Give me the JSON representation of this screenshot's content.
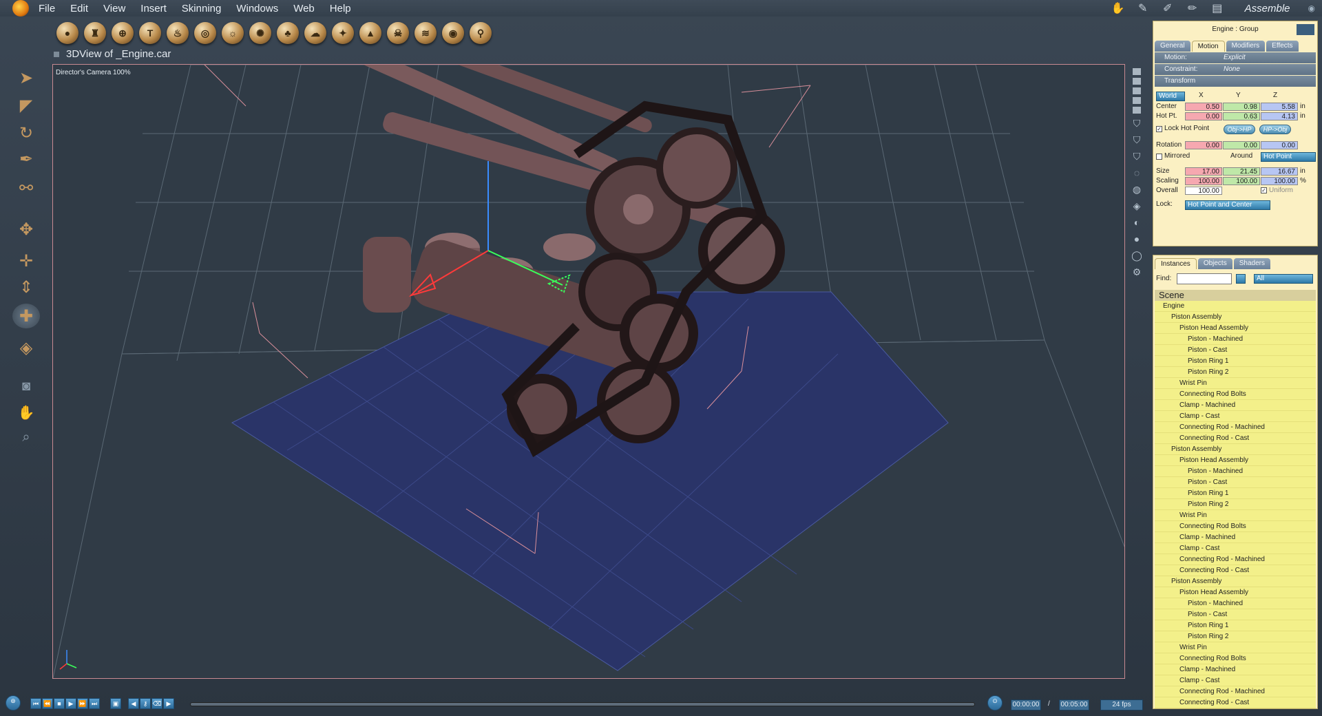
{
  "menubar": {
    "items": [
      "File",
      "Edit",
      "View",
      "Insert",
      "Skinning",
      "Windows",
      "Web",
      "Help"
    ],
    "mode": "Assemble"
  },
  "viewport": {
    "title": "3DView of _Engine.car",
    "camera_label": "Director's Camera 100%"
  },
  "properties": {
    "header": "Engine : Group",
    "tabs": [
      "General",
      "Motion",
      "Modifiers",
      "Effects"
    ],
    "active_tab": "Motion",
    "motion": {
      "label": "Motion:",
      "value": "Explicit"
    },
    "constraint": {
      "label": "Constraint:",
      "value": "None"
    },
    "transform_label": "Transform",
    "space": "World",
    "axes": [
      "X",
      "Y",
      "Z"
    ],
    "center": {
      "label": "Center",
      "x": "0.50",
      "y": "0.98",
      "z": "5.58",
      "unit": "in"
    },
    "hotpoint": {
      "label": "Hot Pt.",
      "x": "0.00",
      "y": "0.63",
      "z": "4.13",
      "unit": "in"
    },
    "lock_hot_point": {
      "label": "Lock Hot Point",
      "checked": true
    },
    "obj_hp_button": "Obj->HP",
    "hp_obj_button": "HP->Obj",
    "rotation": {
      "label": "Rotation",
      "x": "0.00",
      "y": "0.00",
      "z": "0.00"
    },
    "mirrored": {
      "label": "Mirrored",
      "checked": false
    },
    "around": {
      "label": "Around",
      "value": "Hot Point"
    },
    "size": {
      "label": "Size",
      "x": "17.00",
      "y": "21.45",
      "z": "16.67",
      "unit": "in"
    },
    "scaling": {
      "label": "Scaling",
      "x": "100.00",
      "y": "100.00",
      "z": "100.00",
      "unit": "%"
    },
    "overall": {
      "label": "Overall",
      "value": "100.00"
    },
    "uniform": {
      "label": "Uniform",
      "checked": true
    },
    "lock": {
      "label": "Lock:",
      "value": "Hot Point and Center"
    }
  },
  "instances": {
    "tabs": [
      "Instances",
      "Objects",
      "Shaders"
    ],
    "active_tab": "Instances",
    "find_label": "Find:",
    "find_value": "",
    "filter": "All",
    "scene_label": "Scene",
    "tree": [
      {
        "label": "Engine",
        "level": 0
      },
      {
        "label": "Piston Assembly",
        "level": 1
      },
      {
        "label": "Piston Head Assembly",
        "level": 2
      },
      {
        "label": "Piston - Machined",
        "level": 3
      },
      {
        "label": "Piston - Cast",
        "level": 3
      },
      {
        "label": "Piston Ring 1",
        "level": 3
      },
      {
        "label": "Piston Ring 2",
        "level": 3
      },
      {
        "label": "Wrist Pin",
        "level": 2
      },
      {
        "label": "Connecting Rod Bolts",
        "level": 2
      },
      {
        "label": "Clamp - Machined",
        "level": 2
      },
      {
        "label": "Clamp - Cast",
        "level": 2
      },
      {
        "label": "Connecting Rod - Machined",
        "level": 2
      },
      {
        "label": "Connecting Rod - Cast",
        "level": 2
      },
      {
        "label": "Piston Assembly",
        "level": 1
      },
      {
        "label": "Piston Head Assembly",
        "level": 2
      },
      {
        "label": "Piston - Machined",
        "level": 3
      },
      {
        "label": "Piston - Cast",
        "level": 3
      },
      {
        "label": "Piston Ring 1",
        "level": 3
      },
      {
        "label": "Piston Ring 2",
        "level": 3
      },
      {
        "label": "Wrist Pin",
        "level": 2
      },
      {
        "label": "Connecting Rod Bolts",
        "level": 2
      },
      {
        "label": "Clamp - Machined",
        "level": 2
      },
      {
        "label": "Clamp - Cast",
        "level": 2
      },
      {
        "label": "Connecting Rod - Machined",
        "level": 2
      },
      {
        "label": "Connecting Rod - Cast",
        "level": 2
      },
      {
        "label": "Piston Assembly",
        "level": 1
      },
      {
        "label": "Piston Head Assembly",
        "level": 2
      },
      {
        "label": "Piston - Machined",
        "level": 3
      },
      {
        "label": "Piston - Cast",
        "level": 3
      },
      {
        "label": "Piston Ring 1",
        "level": 3
      },
      {
        "label": "Piston Ring 2",
        "level": 3
      },
      {
        "label": "Wrist Pin",
        "level": 2
      },
      {
        "label": "Connecting Rod Bolts",
        "level": 2
      },
      {
        "label": "Clamp - Machined",
        "level": 2
      },
      {
        "label": "Clamp - Cast",
        "level": 2
      },
      {
        "label": "Connecting Rod - Machined",
        "level": 2
      },
      {
        "label": "Connecting Rod - Cast",
        "level": 2
      }
    ]
  },
  "timeline": {
    "current_time": "00:00:00",
    "separator": "/",
    "end_time": "00:05:00",
    "fps": "24 fps"
  },
  "colors": {
    "panel_bg": "#fbf0c3",
    "tree_highlight": "#f3f08a",
    "accent_blue": "#2e79a8",
    "viewport_bg": "#303b46",
    "floor": "#2a3468",
    "engine_metal": "#7a5a5c"
  }
}
